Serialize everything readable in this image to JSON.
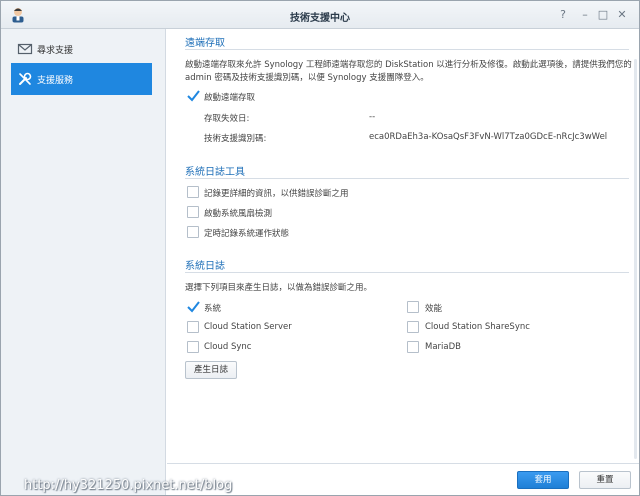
{
  "window": {
    "title": "技術支援中心",
    "controls": [
      "?",
      "–",
      "□",
      "✕"
    ]
  },
  "sidebar": {
    "items": [
      {
        "label": "尋求支援",
        "icon": "mail-icon",
        "active": false
      },
      {
        "label": "支援服務",
        "icon": "tools-icon",
        "active": true
      }
    ]
  },
  "remote_access": {
    "title": "遠端存取",
    "description_line1": "啟動遠端存取來允許 Synology 工程師遠端存取您的 DiskStation 以進行分析及修復。啟動此選項後，請提供我們您的",
    "description_line2": "admin 密碼及技術支援識別碼，以便 Synology 支援團隊登入。",
    "enable_label": "啟動遠端存取",
    "enable_checked": true,
    "expiry_label": "存取失效日:",
    "expiry_value": "--",
    "support_id_label": "技術支援識別碼:",
    "support_id_value": "eca0RDaEh3a-KOsaQsF3FvN-Wl7Tza0GDcE-nRcJc3wWel"
  },
  "log_tools": {
    "title": "系統日誌工具",
    "options": [
      {
        "label": "記錄更詳細的資訊，以供錯誤診斷之用",
        "checked": false
      },
      {
        "label": "啟動系統風扇檢測",
        "checked": false
      },
      {
        "label": "定時記錄系統運作狀態",
        "checked": false
      }
    ]
  },
  "system_logs": {
    "title": "系統日誌",
    "description": "選擇下列項目來產生日誌，以做為錯誤診斷之用。",
    "items": [
      {
        "label": "系統",
        "checked": true
      },
      {
        "label": "效能",
        "checked": false
      },
      {
        "label": "Cloud Station Server",
        "checked": false
      },
      {
        "label": "Cloud Station ShareSync",
        "checked": false
      },
      {
        "label": "Cloud Sync",
        "checked": false
      },
      {
        "label": "MariaDB",
        "checked": false
      }
    ],
    "generate_button": "產生日誌"
  },
  "footer": {
    "apply_label": "套用",
    "reset_label": "重置"
  },
  "watermark": "http://hy321250.pixnet.net/blog",
  "colors": {
    "accent": "#1f87e0",
    "section_title": "#1e6fb8"
  }
}
